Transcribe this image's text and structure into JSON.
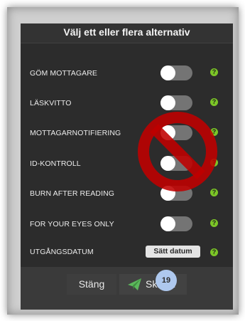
{
  "dialog": {
    "title": "Välj ett eller flera alternativ"
  },
  "options": [
    {
      "label": "GÖM MOTTAGARE",
      "enabled": false,
      "help": "?"
    },
    {
      "label": "LÄSKVITTO",
      "enabled": false,
      "help": "?"
    },
    {
      "label": "MOTTAGARNOTIFIERING",
      "enabled": false,
      "help": "?"
    },
    {
      "label": "ID-KONTROLL",
      "enabled": false,
      "help": "?"
    },
    {
      "label": "BURN AFTER READING",
      "enabled": false,
      "help": "?"
    },
    {
      "label": "FOR YOUR EYES ONLY",
      "enabled": false,
      "help": "?"
    }
  ],
  "expiry": {
    "label": "UTGÅNGSDATUM",
    "button_label": "Sätt datum",
    "help": "?"
  },
  "footer": {
    "close_label": "Stäng",
    "send_label": "Skicka"
  },
  "step_badge": "19",
  "icons": {
    "send": "paper-plane-icon",
    "help": "question-icon",
    "overlay": "prohibited-icon"
  },
  "colors": {
    "help_green": "#7cc627",
    "prohibit_red": "#c00000",
    "badge_blue": "#aec8ee",
    "send_green": "#5cb85c"
  }
}
